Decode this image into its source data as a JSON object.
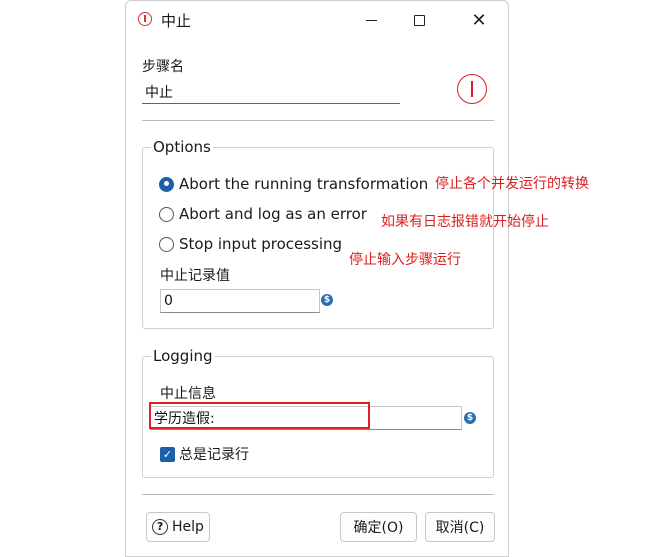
{
  "window": {
    "title": "中止"
  },
  "step_name": {
    "label": "步骤名",
    "value": "中止"
  },
  "options": {
    "title": "Options",
    "radios": [
      {
        "label": "Abort the running transformation",
        "checked": true
      },
      {
        "label": "Abort and log as an error",
        "checked": false
      },
      {
        "label": "Stop input processing",
        "checked": false
      }
    ],
    "threshold_label": "中止记录值",
    "threshold_value": "0"
  },
  "logging": {
    "title": "Logging",
    "message_label": "中止信息",
    "message_value": "学历造假:",
    "always_log_label": "总是记录行",
    "always_log_checked": true
  },
  "buttons": {
    "help": "Help",
    "ok": "确定(O)",
    "cancel": "取消(C)"
  },
  "annotations": {
    "abort_transformation": "停止各个并发运行的转换",
    "abort_log_error": "如果有日志报错就开始停止",
    "stop_input": "停止输入步骤运行"
  },
  "colors": {
    "accent": "#1f5fa8",
    "annotation": "#d92020"
  }
}
